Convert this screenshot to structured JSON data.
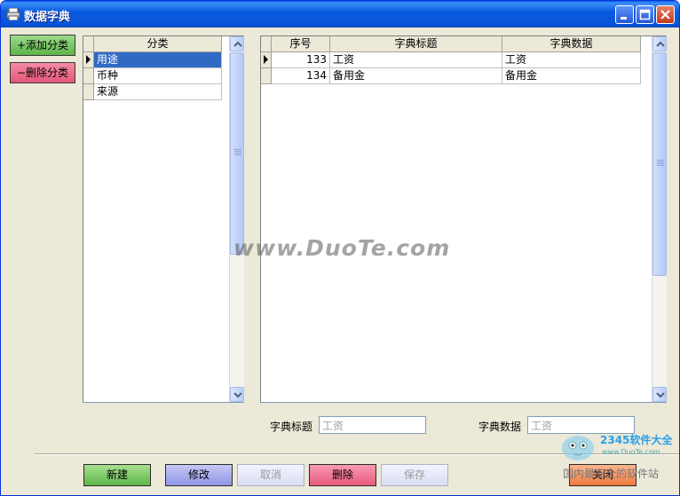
{
  "window": {
    "title": "数据字典",
    "colors": {
      "titlebar": "#0756D9",
      "body": "#ECE9D8",
      "selection": "#316AC5"
    }
  },
  "side_buttons": {
    "add_category": "+添加分类",
    "delete_category": "−删除分类"
  },
  "category_grid": {
    "header": "分类",
    "rows": [
      {
        "label": "用途",
        "selected": true
      },
      {
        "label": "币种",
        "selected": false
      },
      {
        "label": "来源",
        "selected": false
      }
    ]
  },
  "dict_grid": {
    "headers": {
      "seq": "序号",
      "title": "字典标题",
      "data": "字典数据"
    },
    "rows": [
      {
        "seq": "133",
        "title": "工资",
        "data": "工资",
        "current": true
      },
      {
        "seq": "134",
        "title": "备用金",
        "data": "备用金",
        "current": false
      }
    ]
  },
  "form": {
    "title_label": "字典标题",
    "title_value": "工资",
    "data_label": "字典数据",
    "data_value": "工资"
  },
  "buttons": {
    "new": "新建",
    "edit": "修改",
    "cancel": "取消",
    "delete": "删除",
    "save": "保存",
    "close": "关闭"
  },
  "overlays": {
    "watermark": "www.DuoTe.com",
    "logo_text": "2345软件大全",
    "logo_url": "www.DuoTe.com",
    "logo_slogan": "国内最安全的软件站"
  }
}
